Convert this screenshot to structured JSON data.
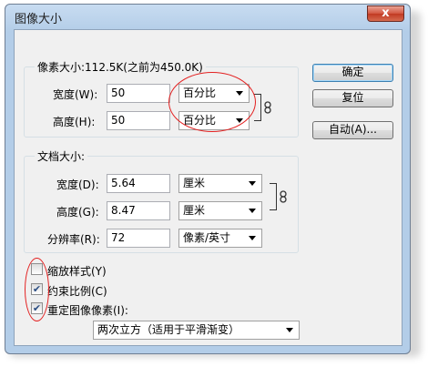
{
  "window": {
    "title": "图像大小",
    "close_label": "x"
  },
  "pixel_dims": {
    "legend": "像素大小:112.5K(之前为450.0K)",
    "width_label": "宽度(W):",
    "width_value": "50",
    "width_unit": "百分比",
    "height_label": "高度(H):",
    "height_value": "50",
    "height_unit": "百分比"
  },
  "doc_size": {
    "legend": "文档大小:",
    "width_label": "宽度(D):",
    "width_value": "5.64",
    "width_unit": "厘米",
    "height_label": "高度(G):",
    "height_value": "8.47",
    "height_unit": "厘米",
    "res_label": "分辨率(R):",
    "res_value": "72",
    "res_unit": "像素/英寸"
  },
  "buttons": {
    "ok": "确定",
    "reset": "复位",
    "auto": "自动(A)..."
  },
  "options": {
    "scale_styles": {
      "label": "缩放样式(Y)",
      "checked": false
    },
    "constrain": {
      "label": "约束比例(C)",
      "checked": true
    },
    "resample": {
      "label": "重定图像像素(I):",
      "checked": true
    }
  },
  "resample_method": "两次立方（适用于平滑渐变）"
}
